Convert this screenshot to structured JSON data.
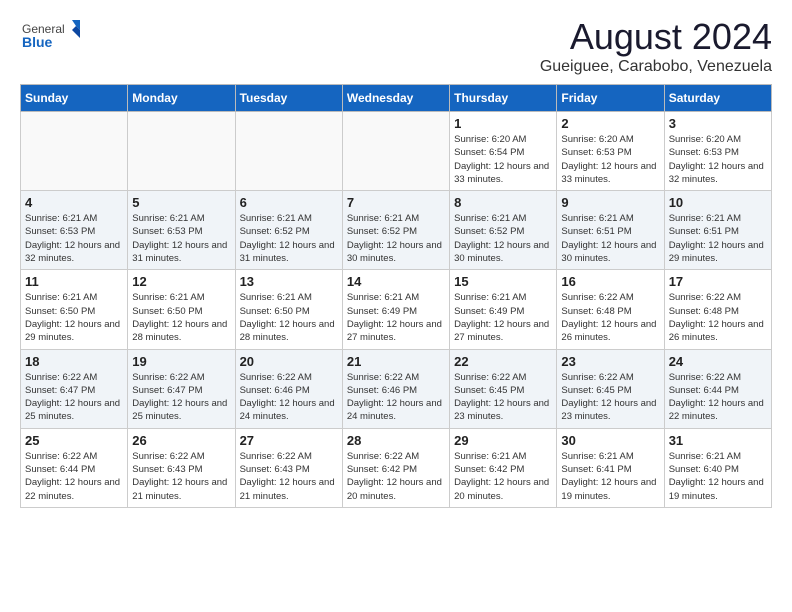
{
  "header": {
    "logo_general": "General",
    "logo_blue": "Blue",
    "title": "August 2024",
    "location": "Gueiguee, Carabobo, Venezuela"
  },
  "weekdays": [
    "Sunday",
    "Monday",
    "Tuesday",
    "Wednesday",
    "Thursday",
    "Friday",
    "Saturday"
  ],
  "weeks": [
    [
      {
        "day": "",
        "info": ""
      },
      {
        "day": "",
        "info": ""
      },
      {
        "day": "",
        "info": ""
      },
      {
        "day": "",
        "info": ""
      },
      {
        "day": "1",
        "info": "Sunrise: 6:20 AM\nSunset: 6:54 PM\nDaylight: 12 hours\nand 33 minutes."
      },
      {
        "day": "2",
        "info": "Sunrise: 6:20 AM\nSunset: 6:53 PM\nDaylight: 12 hours\nand 33 minutes."
      },
      {
        "day": "3",
        "info": "Sunrise: 6:20 AM\nSunset: 6:53 PM\nDaylight: 12 hours\nand 32 minutes."
      }
    ],
    [
      {
        "day": "4",
        "info": "Sunrise: 6:21 AM\nSunset: 6:53 PM\nDaylight: 12 hours\nand 32 minutes."
      },
      {
        "day": "5",
        "info": "Sunrise: 6:21 AM\nSunset: 6:53 PM\nDaylight: 12 hours\nand 31 minutes."
      },
      {
        "day": "6",
        "info": "Sunrise: 6:21 AM\nSunset: 6:52 PM\nDaylight: 12 hours\nand 31 minutes."
      },
      {
        "day": "7",
        "info": "Sunrise: 6:21 AM\nSunset: 6:52 PM\nDaylight: 12 hours\nand 30 minutes."
      },
      {
        "day": "8",
        "info": "Sunrise: 6:21 AM\nSunset: 6:52 PM\nDaylight: 12 hours\nand 30 minutes."
      },
      {
        "day": "9",
        "info": "Sunrise: 6:21 AM\nSunset: 6:51 PM\nDaylight: 12 hours\nand 30 minutes."
      },
      {
        "day": "10",
        "info": "Sunrise: 6:21 AM\nSunset: 6:51 PM\nDaylight: 12 hours\nand 29 minutes."
      }
    ],
    [
      {
        "day": "11",
        "info": "Sunrise: 6:21 AM\nSunset: 6:50 PM\nDaylight: 12 hours\nand 29 minutes."
      },
      {
        "day": "12",
        "info": "Sunrise: 6:21 AM\nSunset: 6:50 PM\nDaylight: 12 hours\nand 28 minutes."
      },
      {
        "day": "13",
        "info": "Sunrise: 6:21 AM\nSunset: 6:50 PM\nDaylight: 12 hours\nand 28 minutes."
      },
      {
        "day": "14",
        "info": "Sunrise: 6:21 AM\nSunset: 6:49 PM\nDaylight: 12 hours\nand 27 minutes."
      },
      {
        "day": "15",
        "info": "Sunrise: 6:21 AM\nSunset: 6:49 PM\nDaylight: 12 hours\nand 27 minutes."
      },
      {
        "day": "16",
        "info": "Sunrise: 6:22 AM\nSunset: 6:48 PM\nDaylight: 12 hours\nand 26 minutes."
      },
      {
        "day": "17",
        "info": "Sunrise: 6:22 AM\nSunset: 6:48 PM\nDaylight: 12 hours\nand 26 minutes."
      }
    ],
    [
      {
        "day": "18",
        "info": "Sunrise: 6:22 AM\nSunset: 6:47 PM\nDaylight: 12 hours\nand 25 minutes."
      },
      {
        "day": "19",
        "info": "Sunrise: 6:22 AM\nSunset: 6:47 PM\nDaylight: 12 hours\nand 25 minutes."
      },
      {
        "day": "20",
        "info": "Sunrise: 6:22 AM\nSunset: 6:46 PM\nDaylight: 12 hours\nand 24 minutes."
      },
      {
        "day": "21",
        "info": "Sunrise: 6:22 AM\nSunset: 6:46 PM\nDaylight: 12 hours\nand 24 minutes."
      },
      {
        "day": "22",
        "info": "Sunrise: 6:22 AM\nSunset: 6:45 PM\nDaylight: 12 hours\nand 23 minutes."
      },
      {
        "day": "23",
        "info": "Sunrise: 6:22 AM\nSunset: 6:45 PM\nDaylight: 12 hours\nand 23 minutes."
      },
      {
        "day": "24",
        "info": "Sunrise: 6:22 AM\nSunset: 6:44 PM\nDaylight: 12 hours\nand 22 minutes."
      }
    ],
    [
      {
        "day": "25",
        "info": "Sunrise: 6:22 AM\nSunset: 6:44 PM\nDaylight: 12 hours\nand 22 minutes."
      },
      {
        "day": "26",
        "info": "Sunrise: 6:22 AM\nSunset: 6:43 PM\nDaylight: 12 hours\nand 21 minutes."
      },
      {
        "day": "27",
        "info": "Sunrise: 6:22 AM\nSunset: 6:43 PM\nDaylight: 12 hours\nand 21 minutes."
      },
      {
        "day": "28",
        "info": "Sunrise: 6:22 AM\nSunset: 6:42 PM\nDaylight: 12 hours\nand 20 minutes."
      },
      {
        "day": "29",
        "info": "Sunrise: 6:21 AM\nSunset: 6:42 PM\nDaylight: 12 hours\nand 20 minutes."
      },
      {
        "day": "30",
        "info": "Sunrise: 6:21 AM\nSunset: 6:41 PM\nDaylight: 12 hours\nand 19 minutes."
      },
      {
        "day": "31",
        "info": "Sunrise: 6:21 AM\nSunset: 6:40 PM\nDaylight: 12 hours\nand 19 minutes."
      }
    ]
  ]
}
